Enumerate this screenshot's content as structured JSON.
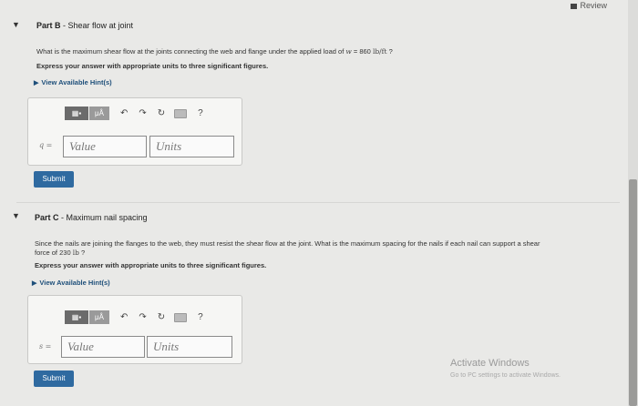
{
  "header": {
    "review_label": "Review"
  },
  "partB": {
    "title_prefix": "Part B",
    "title_text": " - Shear flow at joint",
    "question_text": "What is the maximum shear flow at the joints connecting the web and flange under the applied load of ",
    "load_var": "w",
    "load_equals": " = 860 ",
    "load_unit": "lb/ft",
    "question_end": " ?",
    "instruction": "Express your answer with appropriate units to three significant figures.",
    "hint_label": "View Available Hint(s)",
    "answer_label": "q =",
    "value_placeholder": "Value",
    "units_placeholder": "Units",
    "submit_label": "Submit",
    "mu_label": "μÅ",
    "help_label": "?"
  },
  "partC": {
    "title_prefix": "Part C",
    "title_text": " - Maximum nail spacing",
    "question_line1": "Since the nails are joining the flanges to the web, they must resist the shear flow at the joint. What is the maximum spacing for the nails if each nail can support a shear",
    "question_line2_pre": "force of 230 ",
    "question_unit": "lb",
    "question_end": " ?",
    "instruction": "Express your answer with appropriate units to three significant figures.",
    "hint_label": "View Available Hint(s)",
    "answer_label": "s =",
    "value_placeholder": "Value",
    "units_placeholder": "Units",
    "submit_label": "Submit",
    "mu_label": "μÅ",
    "help_label": "?"
  },
  "overlay": {
    "activate_title": "Activate Windows",
    "activate_sub": "Go to PC settings to activate Windows."
  }
}
